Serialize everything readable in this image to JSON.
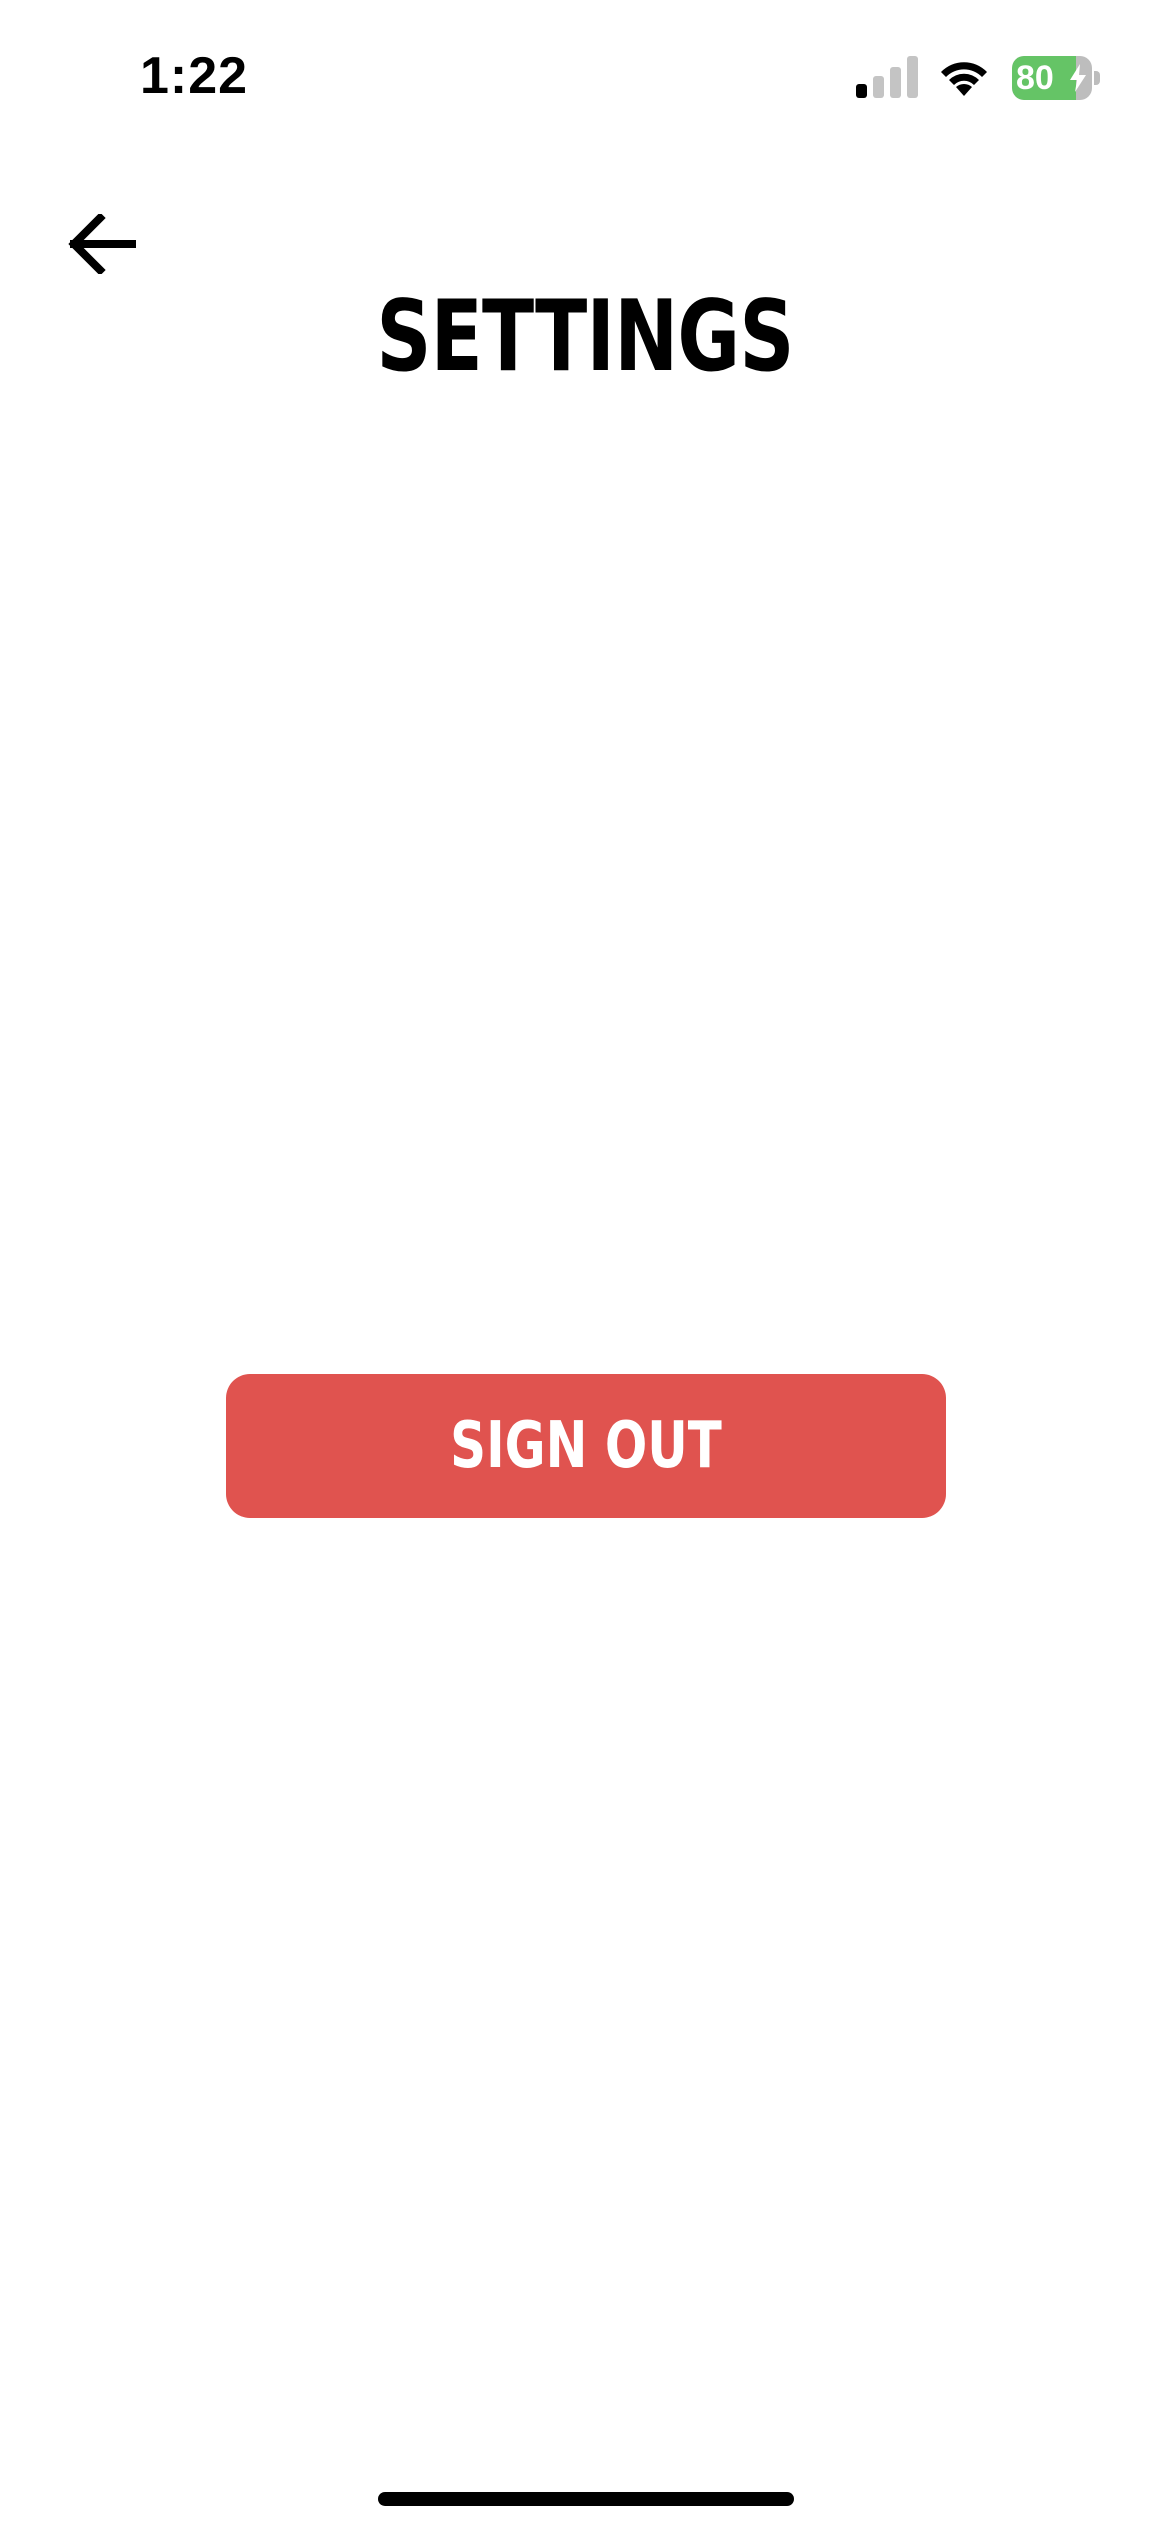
{
  "status_bar": {
    "time": "1:22",
    "battery_percent": "80",
    "battery_level": 0.8,
    "battery_color": "#65c466",
    "cell_signal_bars": 1,
    "charging": true,
    "icons": [
      "cell-signal-icon",
      "wifi-icon",
      "battery-icon",
      "charging-bolt-icon"
    ]
  },
  "header": {
    "back_icon": "arrow-left-icon",
    "title": "SETTINGS"
  },
  "main": {
    "sign_out_label": "SIGN OUT",
    "sign_out_color": "#e0534f"
  }
}
